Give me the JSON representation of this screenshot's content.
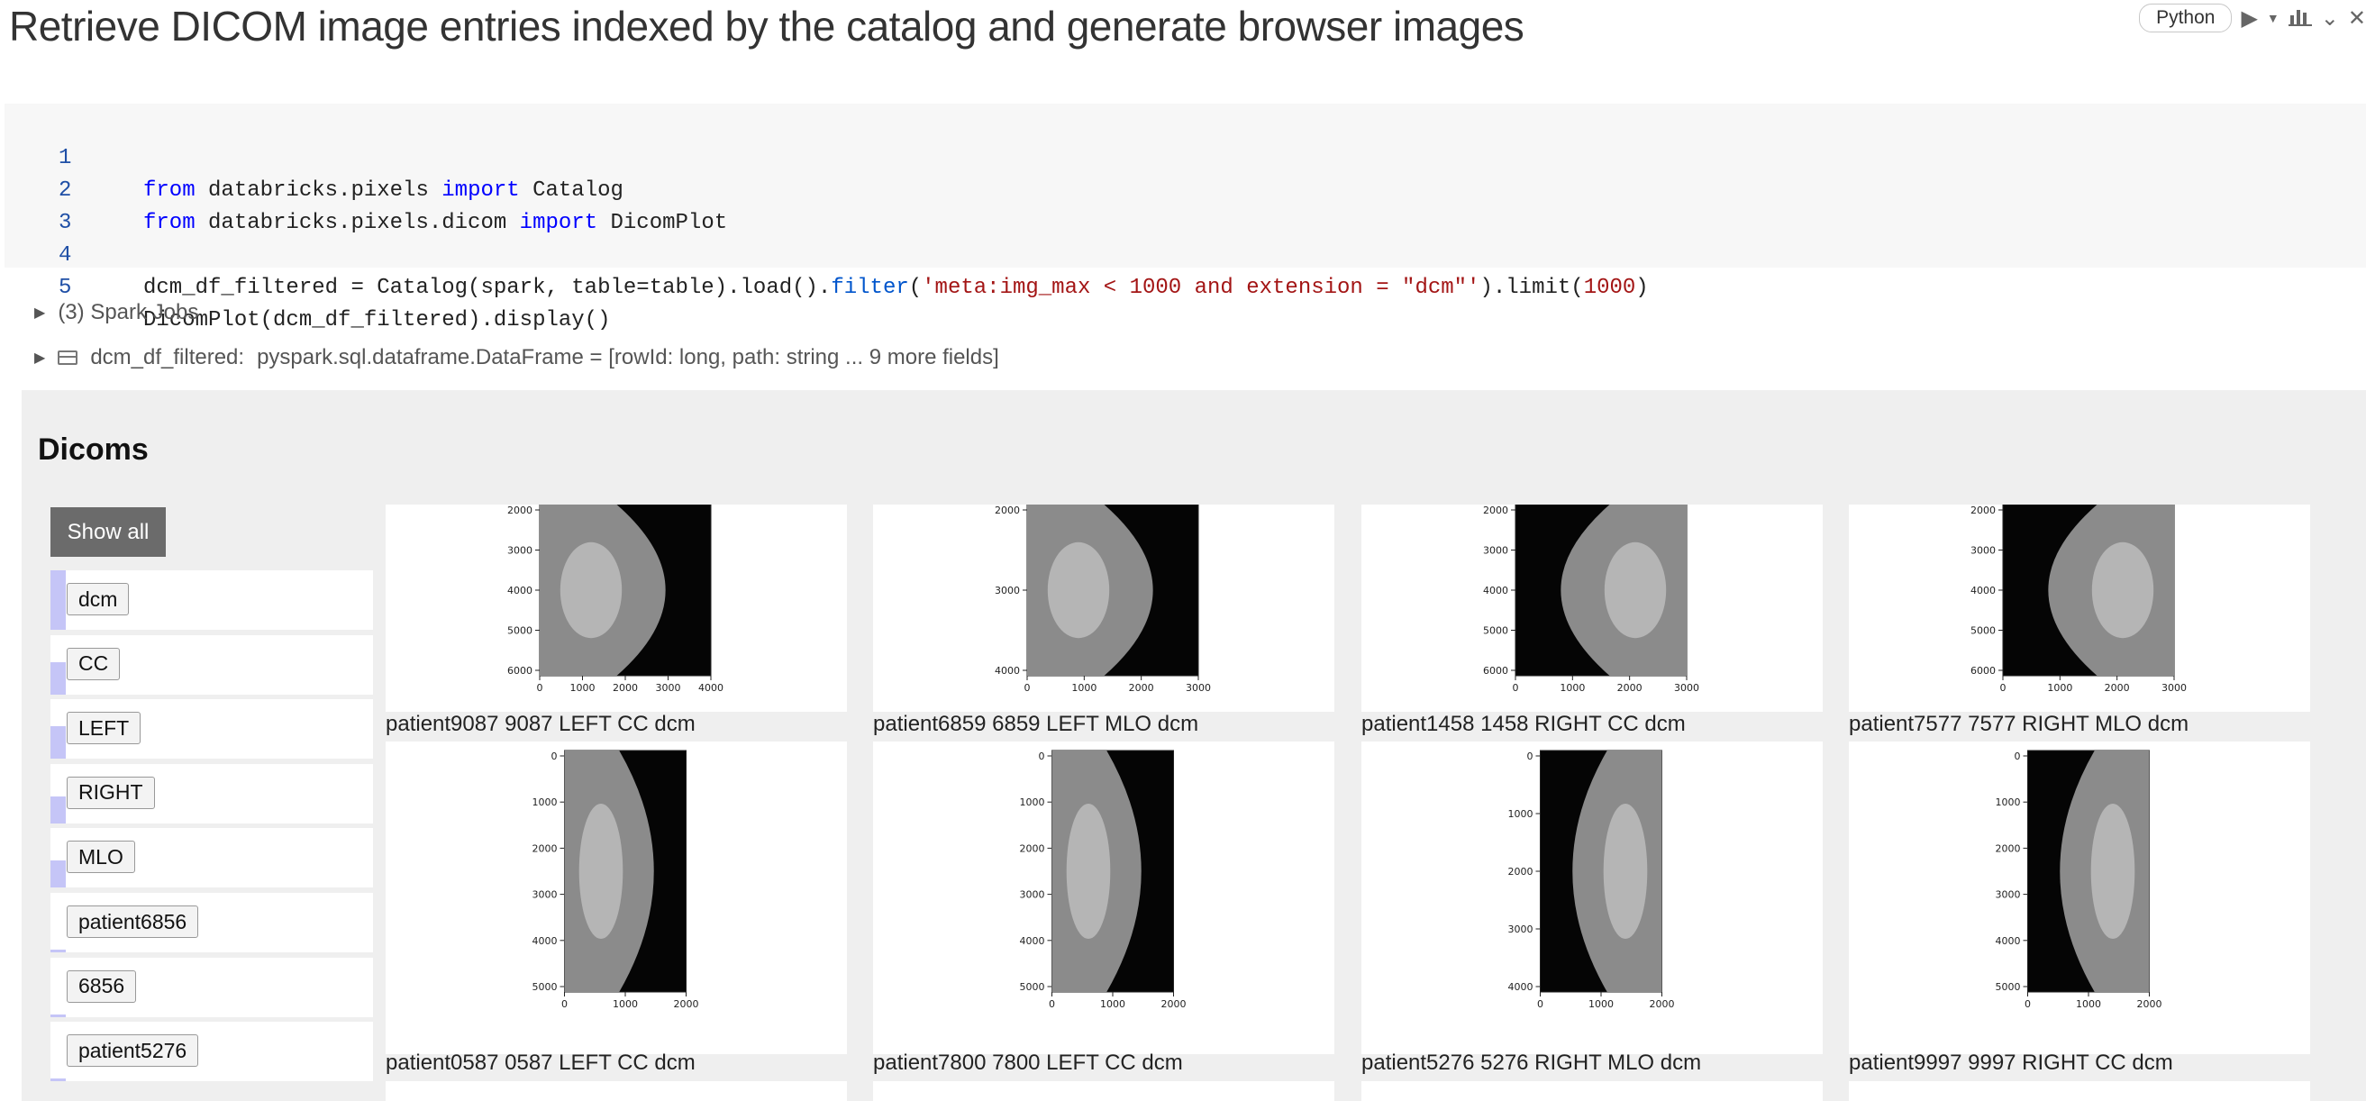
{
  "cell": {
    "title": "Retrieve DICOM image entries indexed by the catalog and generate browser images",
    "language": "Python"
  },
  "code": {
    "line_numbers": [
      "1",
      "2",
      "3",
      "4",
      "5"
    ],
    "line1": {
      "kw1": "from",
      "mod": " databricks.pixels ",
      "kw2": "import",
      "name": " Catalog"
    },
    "line2": {
      "kw1": "from",
      "mod": " databricks.pixels.dicom ",
      "kw2": "import",
      "name": " DicomPlot"
    },
    "line4": {
      "pre": "dcm_df_filtered = Catalog(spark, table=table).load().",
      "fn": "filter",
      "open": "(",
      "str": "'meta:img_max < 1000 and extension = \"dcm\"'",
      "mid": ").limit(",
      "num": "1000",
      "close": ")"
    },
    "line5": "DicomPlot(dcm_df_filtered).display()"
  },
  "outputs": {
    "spark_jobs": "(3) Spark Jobs",
    "df_name": "dcm_df_filtered:",
    "df_type": "pyspark.sql.dataframe.DataFrame = [rowId: long, path: string ... 9 more fields]"
  },
  "viewer": {
    "heading": "Dicoms",
    "show_all": "Show all",
    "filters": [
      "dcm",
      "CC",
      "LEFT",
      "RIGHT",
      "MLO",
      "patient6856",
      "6856",
      "patient5276"
    ],
    "filter_fill": [
      1.0,
      0.55,
      0.55,
      0.45,
      0.45,
      0.05,
      0.05,
      0.05
    ],
    "images": [
      {
        "caption": "patient9087 9087 LEFT CC dcm",
        "x_ticks": [
          "0",
          "1000",
          "2000",
          "3000",
          "4000"
        ],
        "y_ticks": [
          "2000",
          "3000",
          "4000",
          "5000",
          "6000"
        ]
      },
      {
        "caption": "patient6859 6859 LEFT MLO dcm",
        "x_ticks": [
          "0",
          "1000",
          "2000",
          "3000"
        ],
        "y_ticks": [
          "2000",
          "3000",
          "4000"
        ]
      },
      {
        "caption": "patient1458 1458 RIGHT CC dcm",
        "x_ticks": [
          "0",
          "1000",
          "2000",
          "3000"
        ],
        "y_ticks": [
          "2000",
          "3000",
          "4000",
          "5000",
          "6000"
        ]
      },
      {
        "caption": "patient7577 7577 RIGHT MLO dcm",
        "x_ticks": [
          "0",
          "1000",
          "2000",
          "3000"
        ],
        "y_ticks": [
          "2000",
          "3000",
          "4000",
          "5000",
          "6000"
        ]
      },
      {
        "caption": "patient0587 0587 LEFT CC dcm",
        "x_ticks": [
          "0",
          "1000",
          "2000"
        ],
        "y_ticks": [
          "0",
          "1000",
          "2000",
          "3000",
          "4000",
          "5000"
        ]
      },
      {
        "caption": "patient7800 7800 LEFT CC dcm",
        "x_ticks": [
          "0",
          "1000",
          "2000"
        ],
        "y_ticks": [
          "0",
          "1000",
          "2000",
          "3000",
          "4000",
          "5000"
        ]
      },
      {
        "caption": "patient5276 5276 RIGHT MLO dcm",
        "x_ticks": [
          "0",
          "1000",
          "2000"
        ],
        "y_ticks": [
          "0",
          "1000",
          "2000",
          "3000",
          "4000"
        ]
      },
      {
        "caption": "patient9997 9997 RIGHT CC dcm",
        "x_ticks": [
          "0",
          "1000",
          "2000"
        ],
        "y_ticks": [
          "0",
          "1000",
          "2000",
          "3000",
          "4000",
          "5000"
        ]
      }
    ]
  },
  "icons": {
    "run": "run-icon",
    "chart": "chart-icon",
    "collapse": "chevron-down-icon",
    "close": "close-icon"
  },
  "colors": {
    "accent_filter_bar": "#c5c5f7",
    "show_all_bg": "#6b6b6b",
    "keyword": "#0000ff",
    "string": "#a31515"
  }
}
